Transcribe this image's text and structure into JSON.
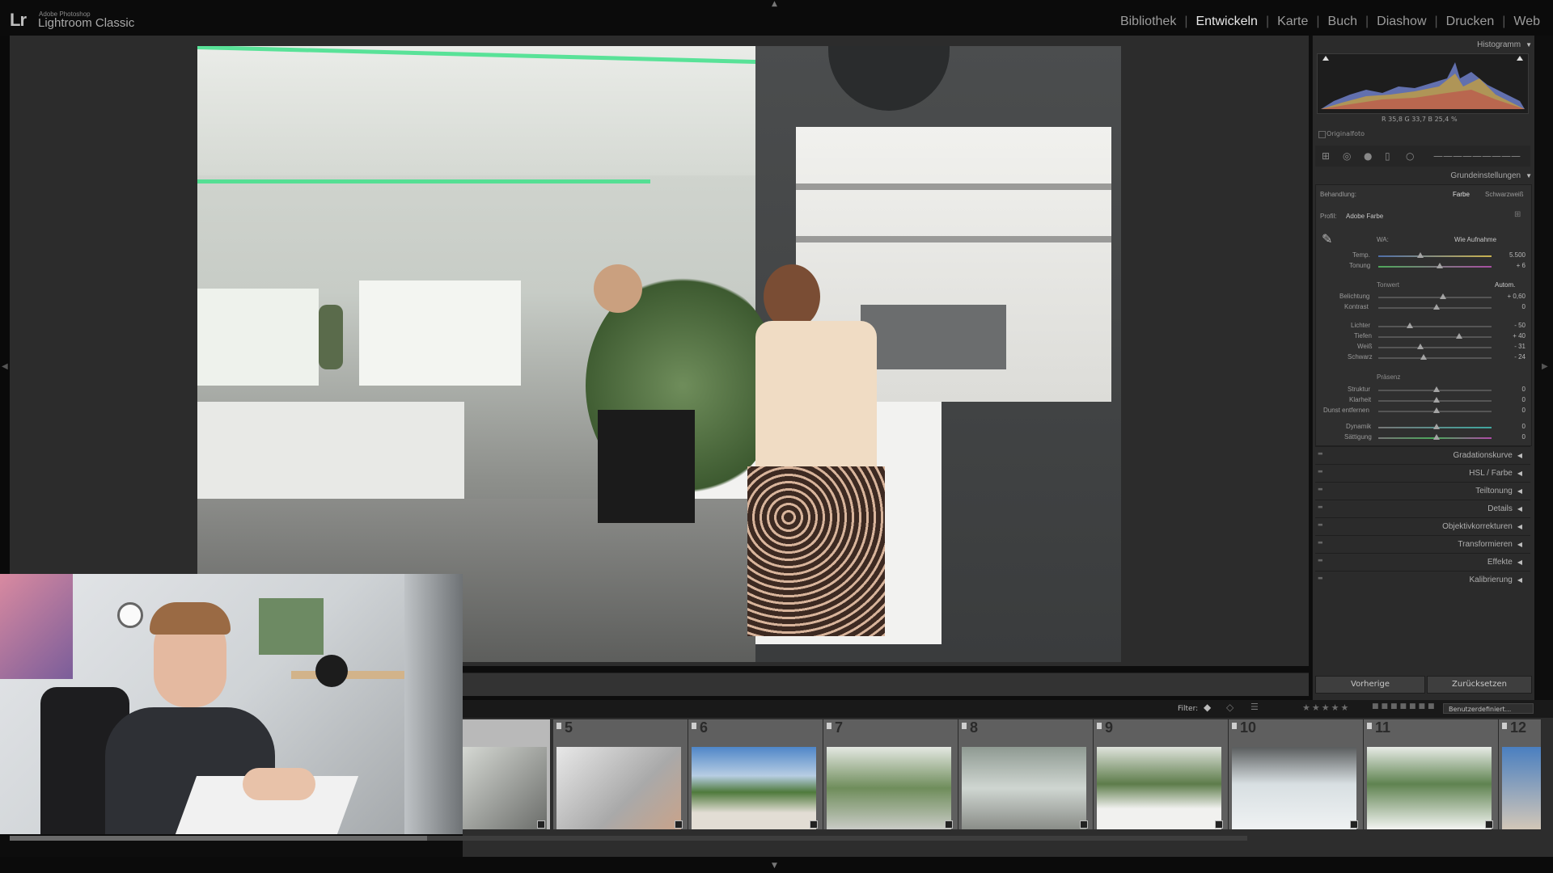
{
  "app": {
    "logo_mark": "Lr",
    "logo_sub": "Adobe Photoshop",
    "logo_name": "Lightroom Classic"
  },
  "modules": [
    {
      "label": "Bibliothek",
      "active": false
    },
    {
      "label": "Entwickeln",
      "active": true
    },
    {
      "label": "Karte",
      "active": false
    },
    {
      "label": "Buch",
      "active": false
    },
    {
      "label": "Diashow",
      "active": false
    },
    {
      "label": "Drucken",
      "active": false
    },
    {
      "label": "Web",
      "active": false
    }
  ],
  "histogram": {
    "title": "Histogramm",
    "readout": "R 35,8  G 33,7  B 25,4 %",
    "original_label": "Originalfoto"
  },
  "basic": {
    "title": "Grundeinstellungen",
    "behandlung_label": "Behandlung:",
    "farbe": "Farbe",
    "schwarzweiss": "Schwarzweiß",
    "profil_label": "Profil:",
    "profil_value": "Adobe Farbe",
    "wa_label": "WA:",
    "wa_value": "Wie Aufnahme",
    "temp_label": "Temp.",
    "temp_value": "5.500",
    "tonung_label": "Tonung",
    "tonung_value": "+ 6",
    "tonwert_label": "Tonwert",
    "autom_label": "Autom.",
    "belichtung_label": "Belichtung",
    "belichtung_value": "+ 0,60",
    "kontrast_label": "Kontrast",
    "kontrast_value": "0",
    "lichter_label": "Lichter",
    "lichter_value": "- 50",
    "tiefen_label": "Tiefen",
    "tiefen_value": "+ 40",
    "weiss_label": "Weiß",
    "weiss_value": "- 31",
    "schwarz_label": "Schwarz",
    "schwarz_value": "- 24",
    "praesenz_label": "Präsenz",
    "struktur_label": "Struktur",
    "struktur_value": "0",
    "klarheit_label": "Klarheit",
    "klarheit_value": "0",
    "dunst_label": "Dunst entfernen",
    "dunst_value": "0",
    "dynamik_label": "Dynamik",
    "dynamik_value": "0",
    "saettigung_label": "Sättigung",
    "saettigung_value": "0"
  },
  "panels": [
    "Gradationskurve",
    "HSL / Farbe",
    "Teiltonung",
    "Details",
    "Objektivkorrekturen",
    "Transformieren",
    "Effekte",
    "Kalibrierung"
  ],
  "buttons": {
    "previous": "Vorherige",
    "reset": "Zurücksetzen"
  },
  "filmstrip": {
    "filter_label": "Filter:",
    "stars": "★★★★★",
    "custom_filter": "Benutzerdefiniert...",
    "frame_numbers": [
      "5",
      "6",
      "7",
      "8",
      "9",
      "10",
      "11",
      "12"
    ]
  }
}
